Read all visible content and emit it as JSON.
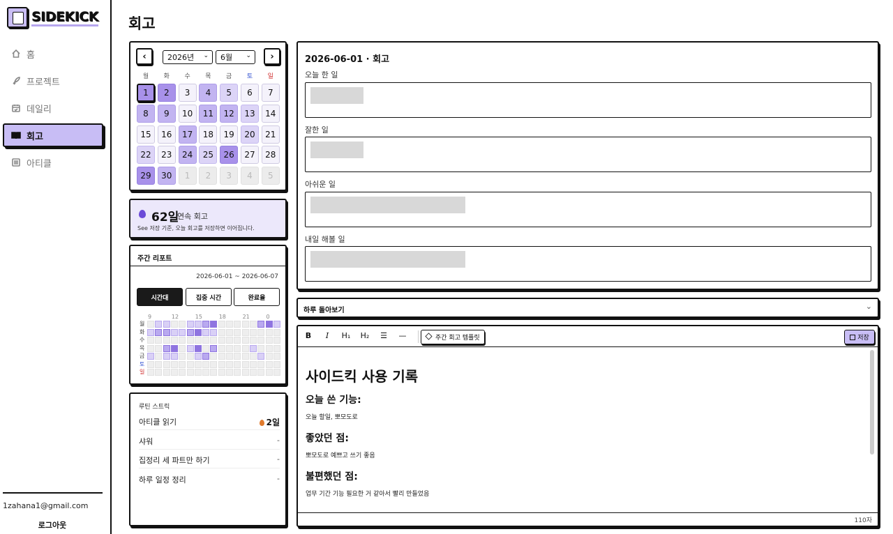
{
  "app": {
    "logo_text": "SIDEKICK"
  },
  "sidebar": {
    "items": [
      {
        "label": "홈",
        "icon": "home-icon"
      },
      {
        "label": "프로젝트",
        "icon": "rocket-icon"
      },
      {
        "label": "데일리",
        "icon": "calendar-check-icon"
      },
      {
        "label": "회고",
        "icon": "book-icon",
        "active": true
      },
      {
        "label": "아티클",
        "icon": "list-icon"
      }
    ],
    "email": "1zahana1@gmail.com",
    "logout": "로그아웃"
  },
  "page": {
    "title": "회고"
  },
  "calendar": {
    "prev": "‹",
    "next": "›",
    "year": "2026년",
    "month": "6월",
    "weekdays": [
      "월",
      "화",
      "수",
      "목",
      "금",
      "토",
      "일"
    ],
    "days": [
      {
        "n": "1",
        "lvl": 3,
        "today": true
      },
      {
        "n": "2",
        "lvl": 3
      },
      {
        "n": "3",
        "lvl": 0
      },
      {
        "n": "4",
        "lvl": 2
      },
      {
        "n": "5",
        "lvl": 1
      },
      {
        "n": "6",
        "lvl": 0
      },
      {
        "n": "7",
        "lvl": 0
      },
      {
        "n": "8",
        "lvl": 2
      },
      {
        "n": "9",
        "lvl": 2
      },
      {
        "n": "10",
        "lvl": 0
      },
      {
        "n": "11",
        "lvl": 2
      },
      {
        "n": "12",
        "lvl": 2
      },
      {
        "n": "13",
        "lvl": 1
      },
      {
        "n": "14",
        "lvl": 0
      },
      {
        "n": "15",
        "lvl": 0
      },
      {
        "n": "16",
        "lvl": 0
      },
      {
        "n": "17",
        "lvl": 2
      },
      {
        "n": "18",
        "lvl": 0
      },
      {
        "n": "19",
        "lvl": 0
      },
      {
        "n": "20",
        "lvl": 1
      },
      {
        "n": "21",
        "lvl": 0
      },
      {
        "n": "22",
        "lvl": 1
      },
      {
        "n": "23",
        "lvl": 0
      },
      {
        "n": "24",
        "lvl": 2
      },
      {
        "n": "25",
        "lvl": 1
      },
      {
        "n": "26",
        "lvl": 3
      },
      {
        "n": "27",
        "lvl": 0
      },
      {
        "n": "28",
        "lvl": 0
      },
      {
        "n": "29",
        "lvl": 3
      },
      {
        "n": "30",
        "lvl": 2
      },
      {
        "n": "1",
        "out": true
      },
      {
        "n": "2",
        "out": true
      },
      {
        "n": "3",
        "out": true
      },
      {
        "n": "4",
        "out": true
      },
      {
        "n": "5",
        "out": true
      }
    ]
  },
  "streak": {
    "count": "62일",
    "label": "연속 회고",
    "description": "See 저장 기준, 오늘 회고를 저장하면 이어집니다."
  },
  "weekly": {
    "title": "주간 리포트",
    "range": "2026-06-01 ~ 2026-06-07",
    "tabs": [
      "시간대",
      "집중 시간",
      "완료율"
    ],
    "hours": [
      "9",
      "12",
      "15",
      "18",
      "21",
      "0"
    ],
    "days": [
      "월",
      "화",
      "수",
      "목",
      "금",
      "토",
      "일"
    ],
    "heatmap": [
      [
        0,
        1,
        1,
        0,
        0,
        1,
        1,
        2,
        3,
        0,
        0,
        0,
        0,
        0,
        2,
        3,
        1
      ],
      [
        1,
        2,
        2,
        1,
        1,
        2,
        3,
        1,
        1,
        0,
        0,
        0,
        0,
        0,
        0,
        0,
        0
      ],
      [
        0,
        0,
        0,
        0,
        0,
        0,
        0,
        0,
        0,
        0,
        0,
        0,
        0,
        0,
        0,
        0,
        0
      ],
      [
        0,
        0,
        2,
        3,
        0,
        1,
        3,
        0,
        2,
        0,
        0,
        0,
        0,
        1,
        0,
        0,
        0
      ],
      [
        1,
        0,
        1,
        1,
        0,
        0,
        1,
        2,
        0,
        0,
        0,
        0,
        0,
        0,
        1,
        0,
        0
      ],
      [
        0,
        0,
        0,
        0,
        0,
        0,
        0,
        0,
        0,
        0,
        0,
        0,
        0,
        0,
        0,
        0,
        0
      ],
      [
        0,
        0,
        0,
        0,
        0,
        0,
        0,
        0,
        0,
        0,
        0,
        0,
        0,
        0,
        0,
        0,
        0
      ]
    ]
  },
  "routine": {
    "title": "루틴 스트릭",
    "items": [
      {
        "name": "아티클 읽기",
        "value": "2일",
        "strong": true
      },
      {
        "name": "샤워",
        "value": "-"
      },
      {
        "name": "집정리 세 파트만 하기",
        "value": "-"
      },
      {
        "name": "하루 일정 정리",
        "value": "-"
      }
    ]
  },
  "form": {
    "title": "2026-06-01 · 회고",
    "fields": [
      {
        "label": "오늘 한 일",
        "blur": 0.1
      },
      {
        "label": "잘한 일",
        "blur": 0.1
      },
      {
        "label": "아쉬운 일",
        "blur": 0.3
      },
      {
        "label": "내일 해볼 일",
        "blur": 0.3
      }
    ]
  },
  "overview": {
    "title": "하루 돌아보기",
    "chevron": "⌄"
  },
  "editor": {
    "toolbar": {
      "bold": "B",
      "italic": "I",
      "h1": "H₁",
      "h2": "H₂",
      "list": "☰",
      "hr": "—"
    },
    "template_button": "주간 회고 템플릿",
    "save_button": "저장",
    "heading": "사이드킥 사용 기록",
    "sections": [
      {
        "title": "오늘 쓴 기능:",
        "body": "오늘 할일, 뽀모도로"
      },
      {
        "title": "좋았던 점:",
        "body": "뽀모도로 예쁘고 쓰기 좋음"
      },
      {
        "title": "불편했던 점:",
        "body": "업무 기간 기능 필요한 거 같아서 빨리 만들었음"
      }
    ],
    "char_count": "110자"
  },
  "colors": {
    "accent": "#c8bdf5",
    "accent_strong": "#a891ea",
    "border": "#111111"
  }
}
